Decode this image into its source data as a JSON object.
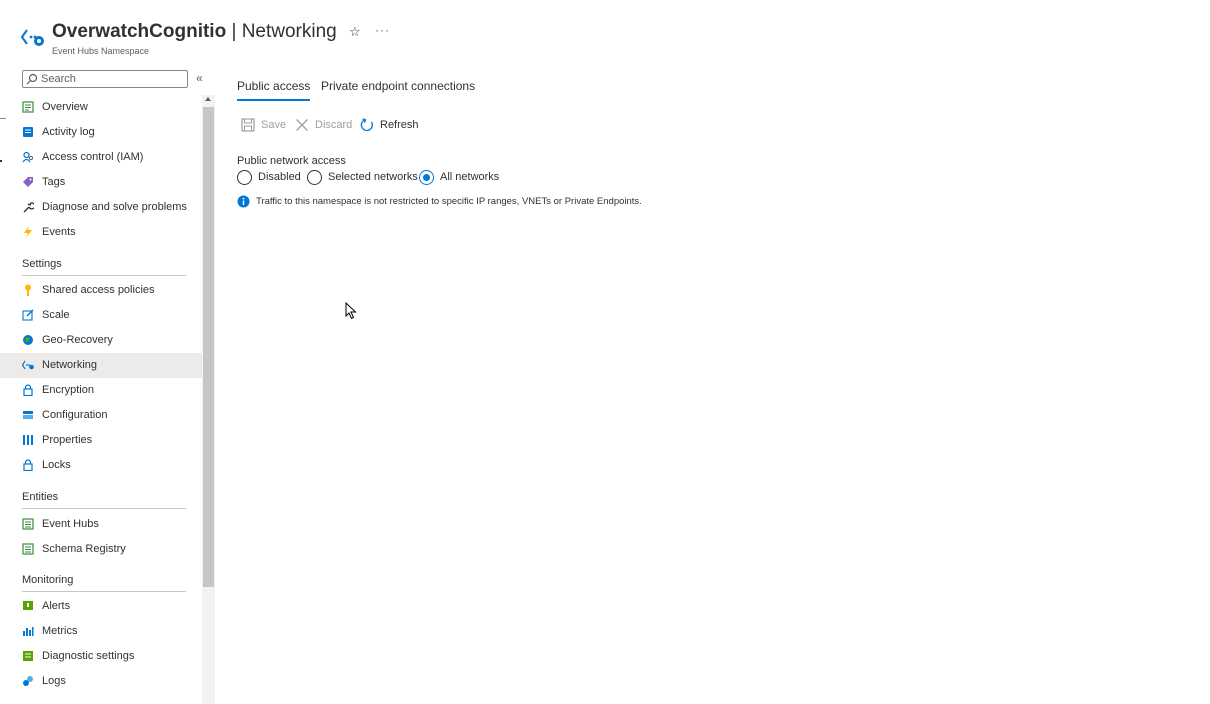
{
  "header": {
    "resource_name": "OverwatchCognitio",
    "separator": " | ",
    "page_name": "Networking",
    "subtitle": "Event Hubs Namespace",
    "resource_icon": "event-hubs-networking-icon",
    "favorite_icon": "star-icon",
    "more_label": "···"
  },
  "sidebar": {
    "search_placeholder": "Search",
    "collapse_label": "«",
    "items": [
      {
        "label": "Overview",
        "icon": "overview-icon",
        "color": "#0078d4"
      },
      {
        "label": "Activity log",
        "icon": "activity-log-icon",
        "color": "#0078d4"
      },
      {
        "label": "Access control (IAM)",
        "icon": "iam-icon",
        "color": "#0078d4"
      },
      {
        "label": "Tags",
        "icon": "tag-icon",
        "color": "#8661c5"
      },
      {
        "label": "Diagnose and solve problems",
        "icon": "wrench-icon",
        "color": "#323130"
      },
      {
        "label": "Events",
        "icon": "lightning-icon",
        "color": "#ffb900"
      }
    ],
    "sections": [
      {
        "title": "Settings",
        "items": [
          {
            "label": "Shared access policies",
            "icon": "key-icon",
            "color": "#ffb900"
          },
          {
            "label": "Scale",
            "icon": "edit-icon",
            "color": "#0078d4"
          },
          {
            "label": "Geo-Recovery",
            "icon": "globe-icon",
            "color": "#0078d4"
          },
          {
            "label": "Networking",
            "icon": "networking-icon",
            "color": "#0078d4",
            "active": true
          },
          {
            "label": "Encryption",
            "icon": "lock-icon",
            "color": "#0078d4"
          },
          {
            "label": "Configuration",
            "icon": "configuration-icon",
            "color": "#0078d4"
          },
          {
            "label": "Properties",
            "icon": "properties-icon",
            "color": "#0078d4"
          },
          {
            "label": "Locks",
            "icon": "lock-icon",
            "color": "#0078d4"
          }
        ]
      },
      {
        "title": "Entities",
        "items": [
          {
            "label": "Event Hubs",
            "icon": "event-hubs-icon",
            "color": "#3a8d3a"
          },
          {
            "label": "Schema Registry",
            "icon": "schema-registry-icon",
            "color": "#3a8d3a"
          }
        ]
      },
      {
        "title": "Monitoring",
        "items": [
          {
            "label": "Alerts",
            "icon": "alerts-icon",
            "color": "#57a300"
          },
          {
            "label": "Metrics",
            "icon": "metrics-icon",
            "color": "#0078d4"
          },
          {
            "label": "Diagnostic settings",
            "icon": "diagnostic-settings-icon",
            "color": "#57a300"
          },
          {
            "label": "Logs",
            "icon": "logs-icon",
            "color": "#0078d4"
          }
        ]
      }
    ]
  },
  "main": {
    "tabs": [
      {
        "label": "Public access",
        "active": true
      },
      {
        "label": "Private endpoint connections",
        "active": false
      }
    ],
    "toolbar": {
      "save_label": "Save",
      "discard_label": "Discard",
      "refresh_label": "Refresh"
    },
    "public_network_access": {
      "label": "Public network access",
      "options": [
        "Disabled",
        "Selected networks",
        "All networks"
      ],
      "selected": "All networks"
    },
    "info_text": "Traffic to this namespace is not restricted to specific IP ranges, VNETs or Private Endpoints."
  },
  "colors": {
    "accent": "#0078d4",
    "active_nav_bg": "#edebe9",
    "text": "#323130",
    "disabled_text": "#a19f9d"
  }
}
